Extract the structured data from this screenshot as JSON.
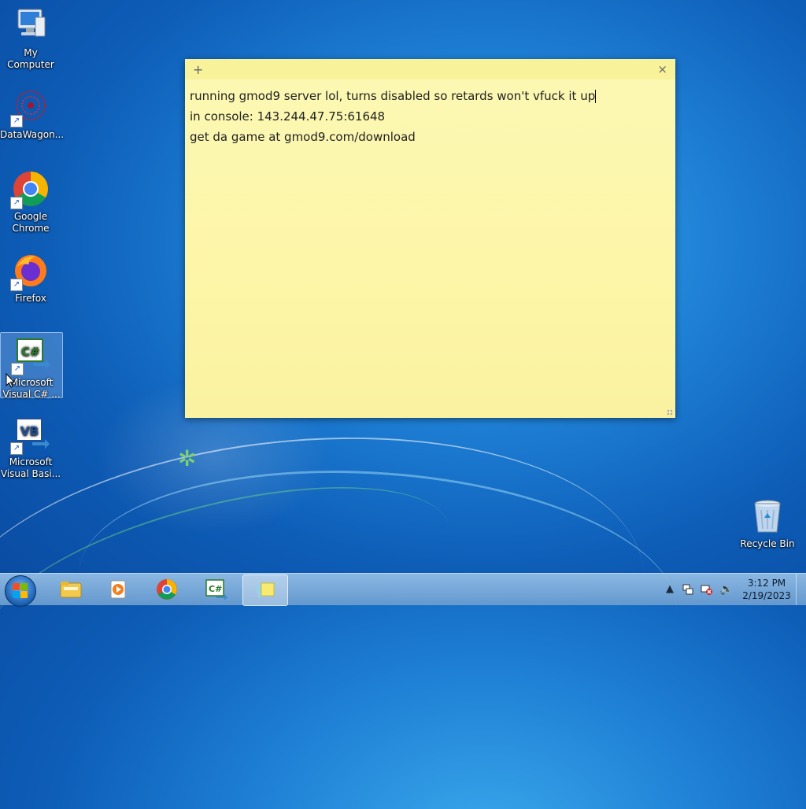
{
  "desktop": {
    "icons": [
      {
        "label": "My Computer"
      },
      {
        "label": "DataWagon..."
      },
      {
        "label": "Google Chrome"
      },
      {
        "label": "Firefox"
      },
      {
        "label": "Microsoft Visual C# ..."
      },
      {
        "label": "Microsoft Visual Basi..."
      },
      {
        "label": "Recycle Bin"
      }
    ]
  },
  "sticky_note": {
    "add_glyph": "+",
    "close_glyph": "×",
    "lines": [
      "running gmod9 server lol, turns disabled so retards won't vfuck it up",
      "in console: 143.244.47.75:61648",
      "get da game at gmod9.com/download"
    ]
  },
  "taskbar": {
    "clock_time": "3:12 PM",
    "clock_date": "2/19/2023"
  }
}
